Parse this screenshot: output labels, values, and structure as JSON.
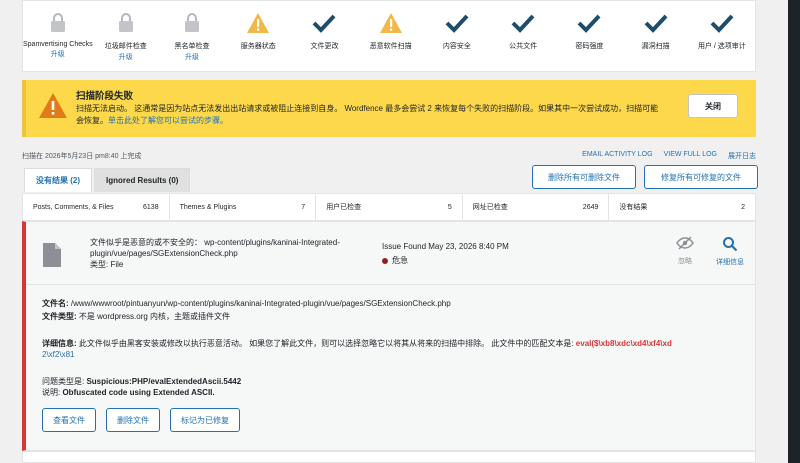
{
  "stages": [
    {
      "label": "Spamvertising Checks",
      "sub": "升级",
      "status": "locked"
    },
    {
      "label": "垃圾邮件检查",
      "sub": "升级",
      "status": "locked"
    },
    {
      "label": "黑名单检查",
      "sub": "升级",
      "status": "locked"
    },
    {
      "label": "服务器状态",
      "sub": "",
      "status": "warning"
    },
    {
      "label": "文件更改",
      "sub": "",
      "status": "ok"
    },
    {
      "label": "恶意软件扫描",
      "sub": "",
      "status": "warning"
    },
    {
      "label": "内容安全",
      "sub": "",
      "status": "ok"
    },
    {
      "label": "公共文件",
      "sub": "",
      "status": "ok"
    },
    {
      "label": "密码强度",
      "sub": "",
      "status": "ok"
    },
    {
      "label": "漏洞扫描",
      "sub": "",
      "status": "ok"
    },
    {
      "label": "用户 / 选项审计",
      "sub": "",
      "status": "ok"
    }
  ],
  "banner": {
    "title": "扫描阶段失败",
    "message": "扫描无法启动。 这通常是因为站点无法发出出站请求或被阻止连接到自身。 Wordfence 最多会尝试 2 来恢复每个失败的扫描阶段。如果其中一次尝试成功，扫描可能会恢复。",
    "link": "单击此处了解您可以尝试的步骤。",
    "close_label": "关闭"
  },
  "scan_time": "扫描在 2026年5月23日 pm8:40 上完成",
  "header_links": [
    "EMAIL ACTIVITY LOG",
    "VIEW FULL LOG",
    "展开日志"
  ],
  "tabs": {
    "active": "没有结果 (2)",
    "inactive": "Ignored Results (0)"
  },
  "buttons": {
    "delete_all": "删除所有可删除文件",
    "repair_all": "修复所有可修复的文件"
  },
  "stats": [
    {
      "label": "Posts, Comments, & Files",
      "value": "6138"
    },
    {
      "label": "Themes & Plugins",
      "value": "7"
    },
    {
      "label": "用户已检查",
      "value": "5"
    },
    {
      "label": "网址已检查",
      "value": "2649"
    },
    {
      "label": "没有结果",
      "value": "2"
    }
  ],
  "issue": {
    "summary": "文件似乎是恶意的或不安全的： wp-content/plugins/kaninai-Integrated-plugin/vue/pages/SGExtensionCheck.php",
    "type_line": "类型: File",
    "found": "Issue Found May 23, 2026 8:40 PM",
    "severity": "危急",
    "ignore_label": "忽略",
    "details_label": "详细信息",
    "filename_label": "文件名:",
    "filename": " /www/wwwroot/pintuanyun/wp-content/plugins/kaninai-Integrated-plugin/vue/pages/SGExtensionCheck.php",
    "filetype_label": "文件类型:",
    "filetype": " 不是 wordpress.org 内核，主题或插件文件",
    "desc_label": "详细信息:",
    "desc": " 此文件似乎由黑客安装或修改以执行恶意活动。 如果您了解此文件，则可以选择忽略它以将其从将来的扫描中排除。 此文件中的匹配文本是:",
    "match": "eval($\\xb8\\xdc\\xd4\\xf4\\xd",
    "match_cont": "2\\xf2\\x81",
    "issue_type_label": "问题类型是:",
    "issue_type": " Suspicious:PHP/evalExtendedAscii.5442",
    "note_label": "说明:",
    "note": "   Obfuscated code using Extended ASCII.",
    "view_file": "查看文件",
    "delete_file": "删除文件",
    "mark_fixed": "标记为已修复"
  },
  "colors": {
    "accent": "#2271b1",
    "warning": "#f0b849",
    "ok": "#1e4d6b",
    "danger": "#d63638",
    "banner": "#fcd84a"
  }
}
